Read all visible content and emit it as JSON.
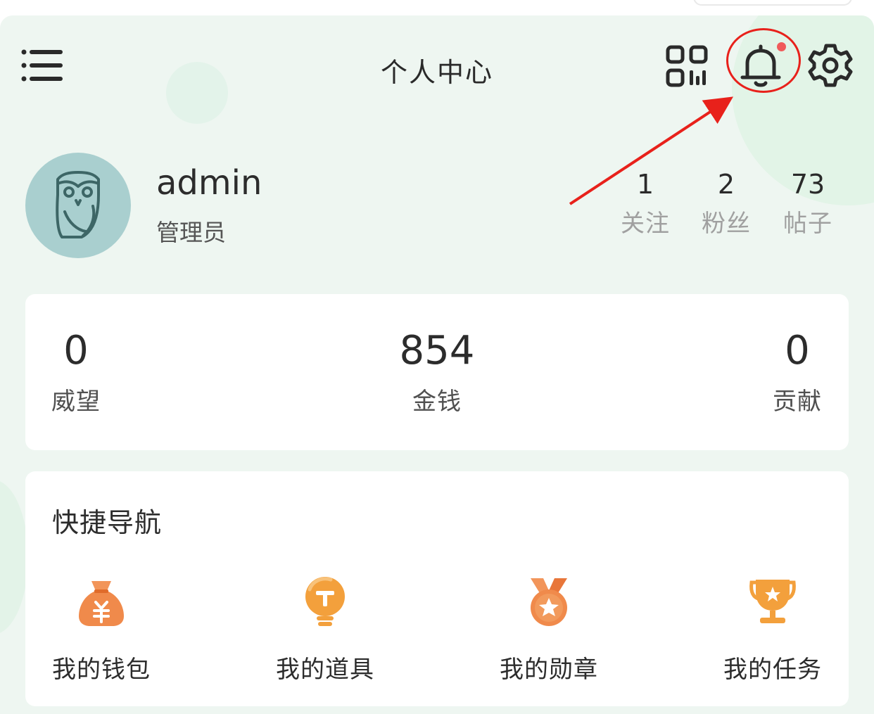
{
  "header": {
    "title": "个人中心",
    "menu_icon": "menu-icon",
    "qr_icon": "qr-code-icon",
    "bell_icon": "bell-icon",
    "settings_icon": "gear-icon",
    "has_unread_notification": true
  },
  "profile": {
    "avatar_icon": "owl-avatar-icon",
    "username": "admin",
    "role": "管理员",
    "stats": [
      {
        "value": "1",
        "label": "关注"
      },
      {
        "value": "2",
        "label": "粉丝"
      },
      {
        "value": "73",
        "label": "帖子"
      }
    ]
  },
  "wealth": [
    {
      "value": "0",
      "label": "威望"
    },
    {
      "value": "854",
      "label": "金钱"
    },
    {
      "value": "0",
      "label": "贡献"
    }
  ],
  "quick_nav": {
    "title": "快捷导航",
    "items": [
      {
        "label": "我的钱包",
        "icon": "money-bag-icon"
      },
      {
        "label": "我的道具",
        "icon": "lightbulb-icon"
      },
      {
        "label": "我的勋章",
        "icon": "medal-icon"
      },
      {
        "label": "我的任务",
        "icon": "trophy-icon"
      }
    ]
  },
  "colors": {
    "background": "#eef6f1",
    "card": "#ffffff",
    "badge_dot": "#f05a5a",
    "annotation_red": "#e8211b",
    "accent_orange": "#f08a3c",
    "muted_text": "#a0a0a0"
  }
}
